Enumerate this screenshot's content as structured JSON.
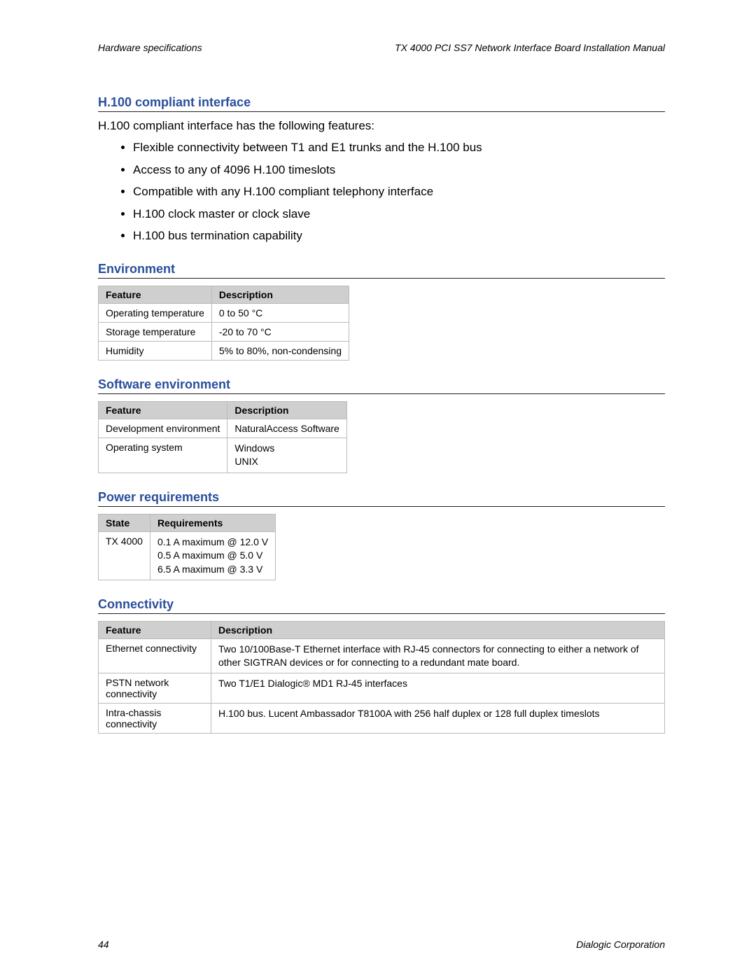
{
  "header": {
    "left": "Hardware specifications",
    "right": "TX 4000 PCI SS7 Network Interface Board Installation Manual"
  },
  "sections": {
    "h100": {
      "title": "H.100 compliant interface",
      "intro": "H.100 compliant interface has the following features:",
      "bullets": [
        "Flexible connectivity between T1 and E1 trunks and the H.100 bus",
        "Access to any of 4096 H.100 timeslots",
        "Compatible with any H.100 compliant telephony interface",
        "H.100 clock master or clock slave",
        "H.100 bus termination capability"
      ]
    },
    "environment": {
      "title": "Environment",
      "cols": [
        "Feature",
        "Description"
      ],
      "rows": [
        {
          "feature": "Operating temperature",
          "desc": "0 to 50 °C"
        },
        {
          "feature": "Storage temperature",
          "desc": "-20 to 70 °C"
        },
        {
          "feature": "Humidity",
          "desc": "5% to 80%, non-condensing"
        }
      ]
    },
    "software": {
      "title": "Software environment",
      "cols": [
        "Feature",
        "Description"
      ],
      "rows": [
        {
          "feature": "Development environment",
          "desc": "NaturalAccess Software"
        },
        {
          "feature": "Operating system",
          "desc": "Windows\nUNIX"
        }
      ]
    },
    "power": {
      "title": "Power requirements",
      "cols": [
        "State",
        "Requirements"
      ],
      "rows": [
        {
          "state": "TX 4000",
          "req": "0.1 A maximum @ 12.0 V\n0.5 A maximum @ 5.0 V\n6.5 A maximum @ 3.3 V"
        }
      ]
    },
    "connectivity": {
      "title": "Connectivity",
      "cols": [
        "Feature",
        "Description"
      ],
      "rows": [
        {
          "feature": "Ethernet connectivity",
          "desc": "Two 10/100Base-T Ethernet interface with RJ-45 connectors for connecting to either a network of other SIGTRAN devices or for connecting to a redundant mate board."
        },
        {
          "feature": "PSTN network connectivity",
          "desc": "Two T1/E1 Dialogic® MD1 RJ-45 interfaces"
        },
        {
          "feature": "Intra-chassis connectivity",
          "desc": "H.100 bus. Lucent Ambassador T8100A with 256 half duplex or 128 full duplex timeslots"
        }
      ]
    }
  },
  "footer": {
    "page": "44",
    "company": "Dialogic Corporation"
  }
}
